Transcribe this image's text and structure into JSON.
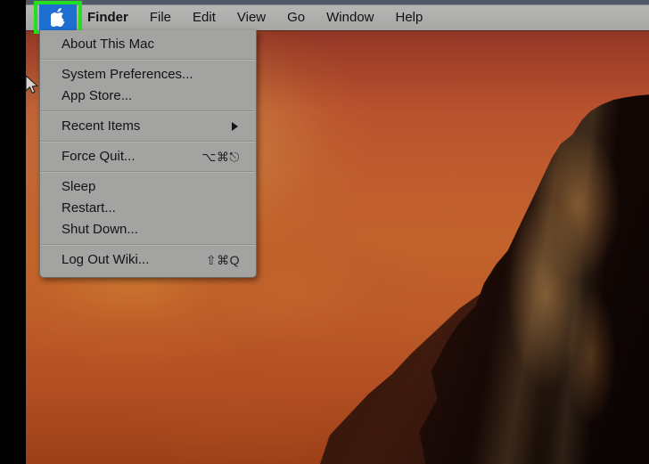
{
  "menubar": {
    "apple_icon": "apple-logo-icon",
    "items": [
      {
        "label": "Finder",
        "bold": true
      },
      {
        "label": "File",
        "bold": false
      },
      {
        "label": "Edit",
        "bold": false
      },
      {
        "label": "View",
        "bold": false
      },
      {
        "label": "Go",
        "bold": false
      },
      {
        "label": "Window",
        "bold": false
      },
      {
        "label": "Help",
        "bold": false
      }
    ]
  },
  "apple_menu": {
    "groups": [
      {
        "items": [
          {
            "label": "About This Mac",
            "shortcut": "",
            "submenu": false
          }
        ]
      },
      {
        "items": [
          {
            "label": "System Preferences...",
            "shortcut": "",
            "submenu": false
          },
          {
            "label": "App Store...",
            "shortcut": "",
            "submenu": false
          }
        ]
      },
      {
        "items": [
          {
            "label": "Recent Items",
            "shortcut": "",
            "submenu": true
          }
        ]
      },
      {
        "items": [
          {
            "label": "Force Quit...",
            "shortcut": "⌥⌘⎋",
            "submenu": false
          }
        ]
      },
      {
        "items": [
          {
            "label": "Sleep",
            "shortcut": "",
            "submenu": false
          },
          {
            "label": "Restart...",
            "shortcut": "",
            "submenu": false
          },
          {
            "label": "Shut Down...",
            "shortcut": "",
            "submenu": false
          }
        ]
      },
      {
        "items": [
          {
            "label": "Log Out Wiki...",
            "shortcut": "⇧⌘Q",
            "submenu": false
          }
        ]
      }
    ]
  },
  "annotation": {
    "highlight_color": "#22e020",
    "highlight_target": "apple-menu-button"
  },
  "desktop": {
    "wallpaper_name": "el-capitan-sunset-wallpaper"
  },
  "cursor": {
    "type": "arrow-pointer"
  }
}
